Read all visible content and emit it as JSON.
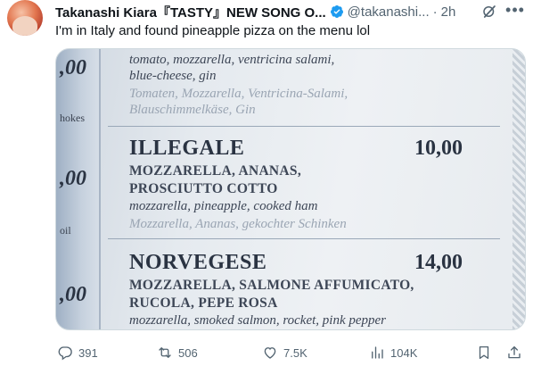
{
  "post": {
    "author_name": "Takanashi Kiara『TASTY』NEW SONG O...",
    "author_handle": "@takanashi...",
    "separator": "·",
    "time": "2h",
    "text": "I'm in Italy and found pineapple pizza on the menu lol"
  },
  "photo": {
    "left_strip": {
      "price_top": ",00",
      "word_hokes": "hokes",
      "price_mid": ",00",
      "word_oil": "oil",
      "price_bottom": ",00"
    },
    "items": [
      {
        "lines": [
          "tomato, mozzarella, ventricina salami,",
          "blue-cheese, gin"
        ],
        "german": [
          "Tomaten, Mozzarella, Ventricina-Salami,",
          "Blauschimmelkäse, Gin"
        ]
      },
      {
        "name": "ILLEGALE",
        "price": "10,00",
        "italian": [
          "MOZZARELLA, ANANAS,",
          "PROSCIUTTO COTTO"
        ],
        "english": "mozzarella, pineapple, cooked ham",
        "german": "Mozzarella, Ananas, gekochter Schinken"
      },
      {
        "name": "NORVEGESE",
        "price": "14,00",
        "italian": [
          "MOZZARELLA, SALMONE AFFUMICATO,",
          "RUCOLA, PEPE ROSA"
        ],
        "english": "mozzarella, smoked salmon, rocket, pink pepper"
      }
    ]
  },
  "actions": {
    "replies": "391",
    "reposts": "506",
    "likes": "7.5K",
    "views": "104K"
  },
  "colors": {
    "verified": "#1d9bf0",
    "secondary": "#536471",
    "text": "#0f1419"
  }
}
